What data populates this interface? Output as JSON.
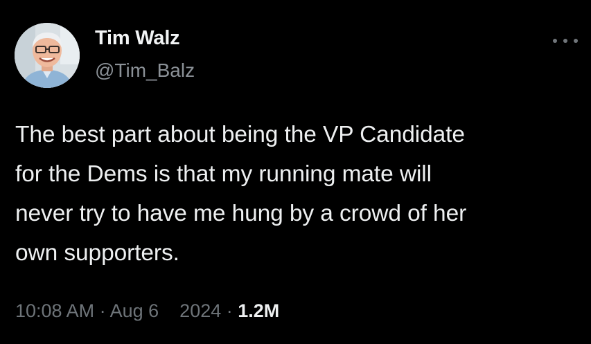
{
  "tweet": {
    "author": {
      "display_name": "Tim Walz",
      "handle": "@Tim_Balz",
      "avatar_icon": "profile-photo"
    },
    "more_icon": "more-horizontal-icon",
    "text": "The best part about being the VP Candidate\nfor the Dems is that my running mate will\nnever try to have me hung by a crowd of her\nown supporters.",
    "meta": {
      "time": "10:08 AM",
      "separator1": " · ",
      "date": "Aug 6",
      "gap": "    ",
      "year": "2024",
      "separator2": " · ",
      "views": "1.2M"
    }
  },
  "colors": {
    "background": "#000000",
    "text_primary": "#e7e9ea",
    "text_secondary": "#71767b"
  }
}
